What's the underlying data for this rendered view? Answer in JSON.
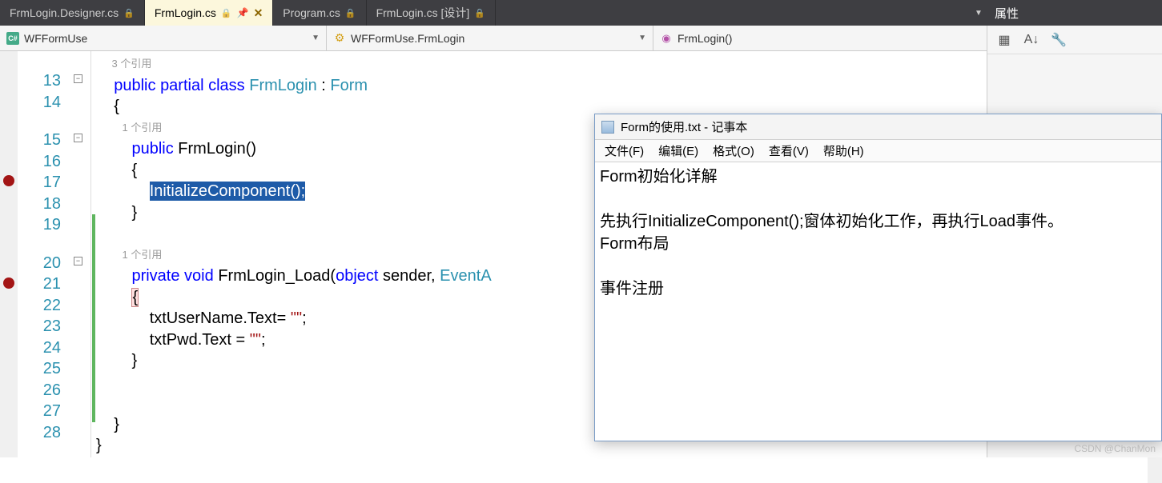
{
  "tabs": [
    {
      "label": "FrmLogin.Designer.cs",
      "locked": true,
      "active": false
    },
    {
      "label": "FrmLogin.cs",
      "locked": true,
      "active": true,
      "pinned": true,
      "closable": true
    },
    {
      "label": "Program.cs",
      "locked": true,
      "active": false
    },
    {
      "label": "FrmLogin.cs [设计]",
      "locked": true,
      "active": false
    }
  ],
  "properties_title": "属性",
  "nav": {
    "scope": "WFFormUse",
    "class": "WFFormUse.FrmLogin",
    "member": "FrmLogin()",
    "csicon": "C#"
  },
  "refs": {
    "r3": "3 个引用",
    "r1a": "1 个引用",
    "r1b": "1 个引用"
  },
  "lines": [
    "13",
    "14",
    "15",
    "16",
    "17",
    "18",
    "19",
    "20",
    "21",
    "22",
    "23",
    "24",
    "25",
    "26",
    "27",
    "28"
  ],
  "code": {
    "l13_kw1": "public",
    "l13_kw2": "partial",
    "l13_kw3": "class",
    "l13_typ1": "FrmLogin",
    "l13_typ2": "Form",
    "l14": "{",
    "l15_kw": "public",
    "l15_name": "FrmLogin",
    "l15_paren": "()",
    "l16": "{",
    "l17_sel": "InitializeComponent();",
    "l18": "}",
    "l20_kw1": "private",
    "l20_kw2": "void",
    "l20_name": "FrmLogin_Load",
    "l20_p1": "(",
    "l20_kw3": "object",
    "l20_p2": " sender, ",
    "l20_typ": "EventA",
    "l21": "{",
    "l22_a": "txtUserName.Text= ",
    "l22_s": "\"\"",
    "l22_b": ";",
    "l23_a": "txtPwd.Text = ",
    "l23_s": "\"\"",
    "l23_b": ";",
    "l24": "}",
    "l27": "}",
    "l28": "}"
  },
  "notepad": {
    "title": "Form的使用.txt - 记事本",
    "menu": [
      "文件(F)",
      "编辑(E)",
      "格式(O)",
      "查看(V)",
      "帮助(H)"
    ],
    "body": [
      "Form初始化详解",
      "",
      "   先执行InitializeComponent();窗体初始化工作，再执行Load事件。",
      "Form布局",
      "",
      "事件注册"
    ]
  },
  "watermark": "CSDN @ChanMon",
  "splitter": "⇕"
}
